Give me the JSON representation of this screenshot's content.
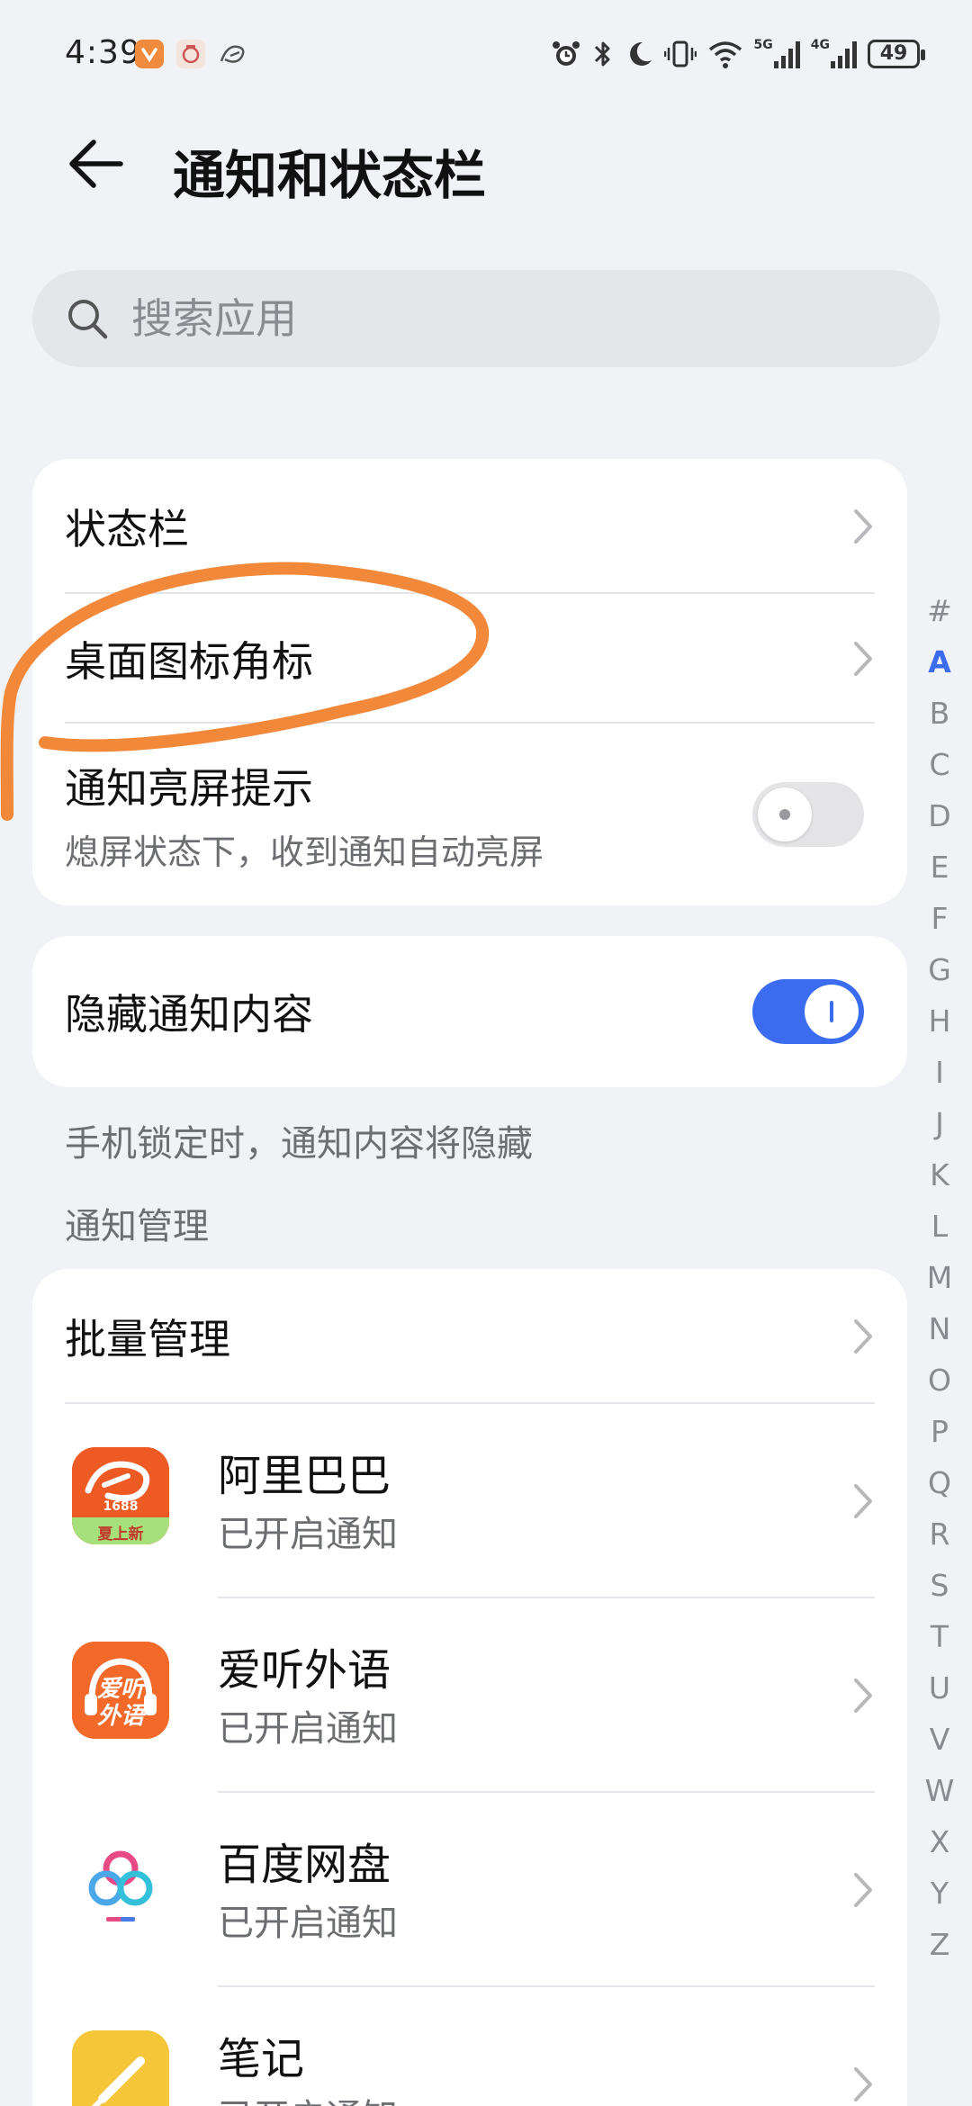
{
  "status_bar": {
    "time": "4:39",
    "battery": "49",
    "network_1": "5G",
    "network_2": "4G"
  },
  "header": {
    "title": "通知和状态栏"
  },
  "search": {
    "placeholder": "搜索应用"
  },
  "settings_card": {
    "status_bar_label": "状态栏",
    "badge_label": "桌面图标角标",
    "wake_label": "通知亮屏提示",
    "wake_sub": "熄屏状态下，收到通知自动亮屏",
    "wake_on": false
  },
  "hide_card": {
    "label": "隐藏通知内容",
    "on": true,
    "description": "手机锁定时，通知内容将隐藏"
  },
  "notification_section": {
    "header": "通知管理",
    "batch_label": "批量管理",
    "apps": [
      {
        "name": "阿里巴巴",
        "status": "已开启通知",
        "icon": "alibaba-1688-icon",
        "icon_text": "1688",
        "icon_tag": "夏上新"
      },
      {
        "name": "爱听外语",
        "status": "已开启通知",
        "icon": "aiting-waiyu-icon",
        "icon_text_1": "爱听",
        "icon_text_2": "外语"
      },
      {
        "name": "百度网盘",
        "status": "已开启通知",
        "icon": "baidu-netdisk-icon"
      },
      {
        "name": "笔记",
        "status": "已开启通知",
        "icon": "notes-icon"
      }
    ]
  },
  "alphabet_index": [
    "#",
    "A",
    "B",
    "C",
    "D",
    "E",
    "F",
    "G",
    "H",
    "I",
    "J",
    "K",
    "L",
    "M",
    "N",
    "O",
    "P",
    "Q",
    "R",
    "S",
    "T",
    "U",
    "V",
    "W",
    "X",
    "Y",
    "Z"
  ],
  "alphabet_active": "A",
  "colors": {
    "accent": "#3b6cf0",
    "background": "#f1f2f6",
    "annotation": "#f2893a"
  }
}
